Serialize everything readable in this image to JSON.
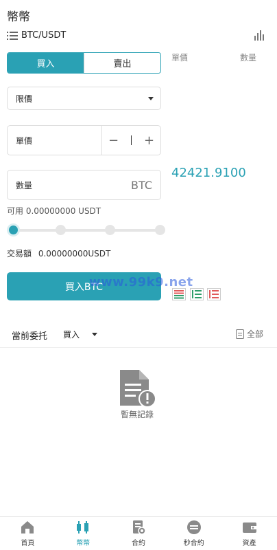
{
  "header": {
    "title": "幣幣",
    "pair": "BTC/USDT",
    "list_icon": "list-icon",
    "chart_icon": "bar-chart-icon"
  },
  "book_columns": {
    "price": "單價",
    "amount": "數量"
  },
  "trade": {
    "tab_buy": "買入",
    "tab_sell": "賣出",
    "active_tab": "buy",
    "order_type": "限價",
    "price_label": "單價",
    "amount_label": "數量",
    "amount_unit": "BTC",
    "available": "可用 0.00000000 USDT",
    "slider_level": 0,
    "turnover_label": "交易額",
    "turnover_value": "0.00000000USDT",
    "submit_label": "買入BTC",
    "watermark": "www.99k9.net"
  },
  "market": {
    "last_price": "42421.9100"
  },
  "orders": {
    "title": "當前委托",
    "filter": "買入",
    "all_label": "全部",
    "empty_text": "暫無記錄"
  },
  "nav": [
    {
      "label": "首頁",
      "icon": "home-icon"
    },
    {
      "label": "幣幣",
      "icon": "candlestick-icon"
    },
    {
      "label": "合約",
      "icon": "contract-icon"
    },
    {
      "label": "秒合約",
      "icon": "second-contract-icon"
    },
    {
      "label": "資產",
      "icon": "wallet-icon"
    }
  ],
  "colors": {
    "accent": "#2aa1b4",
    "depth_green": "#2e9d6a",
    "depth_red": "#e05a5a"
  }
}
